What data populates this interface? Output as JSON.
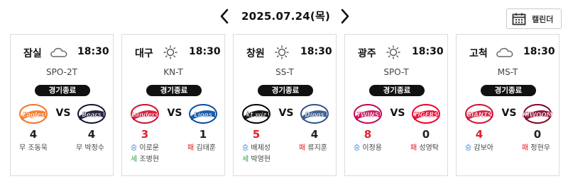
{
  "header": {
    "date": "2025.07.24(목)",
    "calendar_label": "캘린더"
  },
  "games": [
    {
      "stadium": "잠실",
      "weather": "cloud-icon",
      "time": "18:30",
      "channel": "SPO-2T",
      "status": "경기종료",
      "away": {
        "name": "Eagles",
        "logo_text": "Eagles",
        "score": "4",
        "win": false,
        "color": "#f37321"
      },
      "home": {
        "name": "Bears",
        "logo_text": "Bears",
        "score": "4",
        "win": false,
        "color": "#131230"
      },
      "vs": "VS",
      "away_pitcher": {
        "tag": "무",
        "name": "조동욱",
        "type": "d"
      },
      "home_pitcher": {
        "tag": "무",
        "name": "박정수",
        "type": "d"
      },
      "save": null
    },
    {
      "stadium": "대구",
      "weather": "sun-icon",
      "time": "18:30",
      "channel": "KN-T",
      "status": "경기종료",
      "away": {
        "name": "Landers",
        "logo_text": "Landers",
        "score": "3",
        "win": true,
        "color": "#ce0e2d"
      },
      "home": {
        "name": "Lions",
        "logo_text": "Lions",
        "score": "1",
        "win": false,
        "color": "#074ca1"
      },
      "vs": "VS",
      "away_pitcher": {
        "tag": "승",
        "name": "이로운",
        "type": "w"
      },
      "home_pitcher": {
        "tag": "패",
        "name": "김태훈",
        "type": "l"
      },
      "save": {
        "tag": "세",
        "name": "조병현",
        "side": "away"
      }
    },
    {
      "stadium": "창원",
      "weather": "sun-icon",
      "time": "18:30",
      "channel": "SS-T",
      "status": "경기종료",
      "away": {
        "name": "kt wiz",
        "logo_text": "kt wiz",
        "score": "5",
        "win": true,
        "color": "#000000"
      },
      "home": {
        "name": "Dinos",
        "logo_text": "Dinos",
        "score": "4",
        "win": false,
        "color": "#315288"
      },
      "vs": "VS",
      "away_pitcher": {
        "tag": "승",
        "name": "배제성",
        "type": "w"
      },
      "home_pitcher": {
        "tag": "패",
        "name": "류지훈",
        "type": "l"
      },
      "save": {
        "tag": "세",
        "name": "박영현",
        "side": "away"
      }
    },
    {
      "stadium": "광주",
      "weather": "sun-icon",
      "time": "18:30",
      "channel": "SPO-T",
      "status": "경기종료",
      "away": {
        "name": "Twins",
        "logo_text": "TWINS",
        "score": "8",
        "win": true,
        "color": "#c30452"
      },
      "home": {
        "name": "Tigers",
        "logo_text": "TIGERS",
        "score": "0",
        "win": false,
        "color": "#ea0029"
      },
      "vs": "VS",
      "away_pitcher": {
        "tag": "승",
        "name": "이정용",
        "type": "w"
      },
      "home_pitcher": {
        "tag": "패",
        "name": "성영탁",
        "type": "l"
      },
      "save": null
    },
    {
      "stadium": "고척",
      "weather": "cloud-icon",
      "time": "18:30",
      "channel": "MS-T",
      "status": "경기종료",
      "away": {
        "name": "Giants",
        "logo_text": "GIANTS",
        "score": "4",
        "win": true,
        "color": "#d00f31"
      },
      "home": {
        "name": "Kiwoom",
        "logo_text": "KIWOOM",
        "score": "0",
        "win": false,
        "color": "#820024"
      },
      "vs": "VS",
      "away_pitcher": {
        "tag": "승",
        "name": "감보아",
        "type": "w"
      },
      "home_pitcher": {
        "tag": "패",
        "name": "정현우",
        "type": "l"
      },
      "save": null
    }
  ]
}
